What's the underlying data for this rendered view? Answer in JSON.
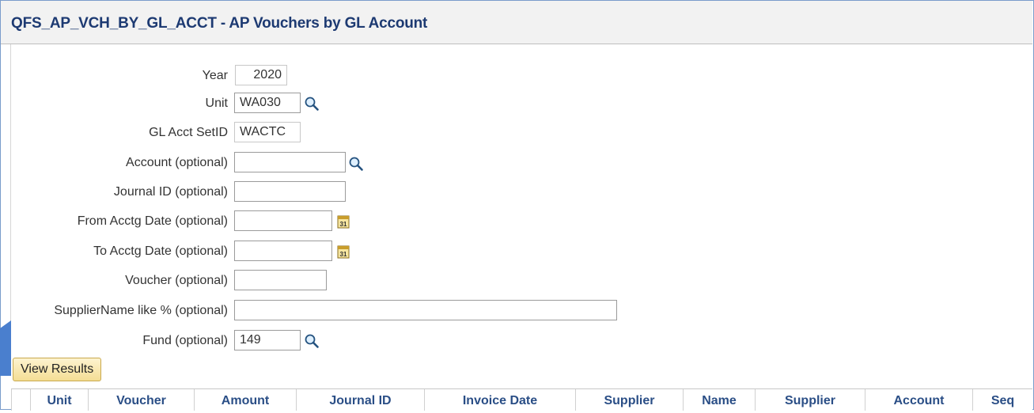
{
  "page": {
    "title": "QFS_AP_VCH_BY_GL_ACCT - AP Vouchers by GL Account"
  },
  "prompts": {
    "year": {
      "label": "Year",
      "value": "2020"
    },
    "unit": {
      "label": "Unit",
      "value": "WA030"
    },
    "setid": {
      "label": "GL Acct SetID",
      "value": "WACTC"
    },
    "account": {
      "label": "Account (optional)",
      "value": ""
    },
    "journal": {
      "label": "Journal ID (optional)",
      "value": ""
    },
    "from_date": {
      "label": "From Acctg Date (optional)",
      "value": ""
    },
    "to_date": {
      "label": "To Acctg Date (optional)",
      "value": ""
    },
    "voucher": {
      "label": "Voucher (optional)",
      "value": ""
    },
    "supplier_name": {
      "label": "SupplierName like % (optional)",
      "value": ""
    },
    "fund": {
      "label": "Fund (optional)",
      "value": "149"
    }
  },
  "actions": {
    "view_results": "View Results"
  },
  "results": {
    "columns": [
      "Unit",
      "Voucher",
      "Amount",
      "Journal ID",
      "Invoice Date",
      "Supplier",
      "Name",
      "Supplier",
      "Account",
      "Seq"
    ]
  },
  "icons": {
    "lookup": "magnifier-icon",
    "calendar": "calendar-icon"
  },
  "colors": {
    "title": "#1d3a72",
    "header_text": "#2a4e86",
    "button_fill": "#f4dd94",
    "accent_tab": "#3f7bcf"
  }
}
